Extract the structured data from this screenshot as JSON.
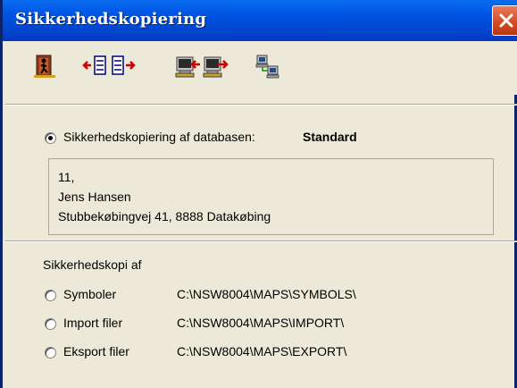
{
  "window": {
    "title": "Sikkerhedskopiering"
  },
  "toolbar": {
    "buttons": [
      {
        "icon": "exit-door-icon"
      },
      {
        "icon": "move-left-icon"
      },
      {
        "icon": "move-right-icon"
      },
      {
        "icon": "import-computer-icon"
      },
      {
        "icon": "export-computer-icon"
      },
      {
        "icon": "network-computers-icon"
      }
    ]
  },
  "database": {
    "radio_label": "Sikkerhedskopiering af databasen:",
    "name": "Standard",
    "selected": true,
    "address": {
      "line1": "11,",
      "line2": "Jens Hansen",
      "line3": "Stubbekøbingvej 41, 8888 Datakøbing"
    }
  },
  "backup_of": {
    "heading": "Sikkerhedskopi af",
    "options": [
      {
        "label": "Symboler",
        "path": "C:\\NSW8004\\MAPS\\SYMBOLS\\",
        "selected": false
      },
      {
        "label": "Import filer",
        "path": "C:\\NSW8004\\MAPS\\IMPORT\\",
        "selected": false
      },
      {
        "label": "Eksport filer",
        "path": "C:\\NSW8004\\MAPS\\EXPORT\\",
        "selected": false
      }
    ]
  },
  "colors": {
    "titlebar": "#0054e3",
    "close_button": "#d24a20",
    "background": "#ece9d8"
  }
}
